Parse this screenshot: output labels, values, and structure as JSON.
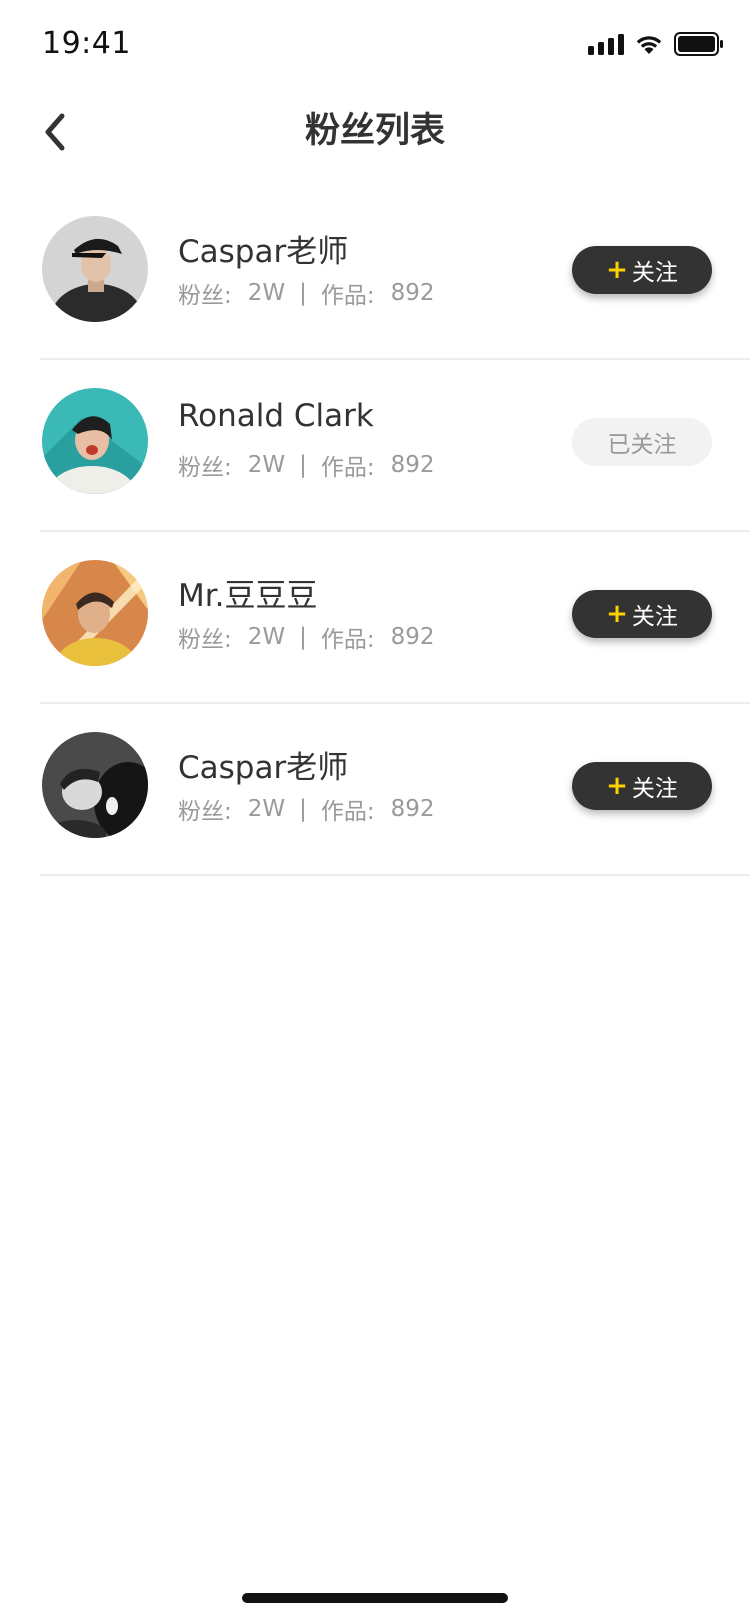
{
  "status_bar": {
    "time": "19:41",
    "icons": [
      "signal-icon",
      "wifi-icon",
      "battery-icon"
    ]
  },
  "nav": {
    "back_icon": "chevron-left-icon",
    "title": "粉丝列表"
  },
  "colors": {
    "accent": "#FFD200",
    "button_dark": "#333333",
    "button_followed_bg": "#F2F2F2",
    "divider": "#ECECEC"
  },
  "fans": [
    {
      "name": "Caspar老师",
      "fans_label": "粉丝:",
      "fans_count": "2W",
      "separator": "|",
      "works_label": "作品:",
      "works_count": "892",
      "followed": false,
      "button_plus": "+",
      "button_label": "关注"
    },
    {
      "name": "Ronald Clark",
      "fans_label": "粉丝:",
      "fans_count": "2W",
      "separator": "|",
      "works_label": "作品:",
      "works_count": "892",
      "followed": true,
      "button_plus": "",
      "button_label": "已关注"
    },
    {
      "name": "Mr.豆豆豆",
      "fans_label": "粉丝:",
      "fans_count": "2W",
      "separator": "|",
      "works_label": "作品:",
      "works_count": "892",
      "followed": false,
      "button_plus": "+",
      "button_label": "关注"
    },
    {
      "name": "Caspar老师",
      "fans_label": "粉丝:",
      "fans_count": "2W",
      "separator": "|",
      "works_label": "作品:",
      "works_count": "892",
      "followed": false,
      "button_plus": "+",
      "button_label": "关注"
    }
  ]
}
